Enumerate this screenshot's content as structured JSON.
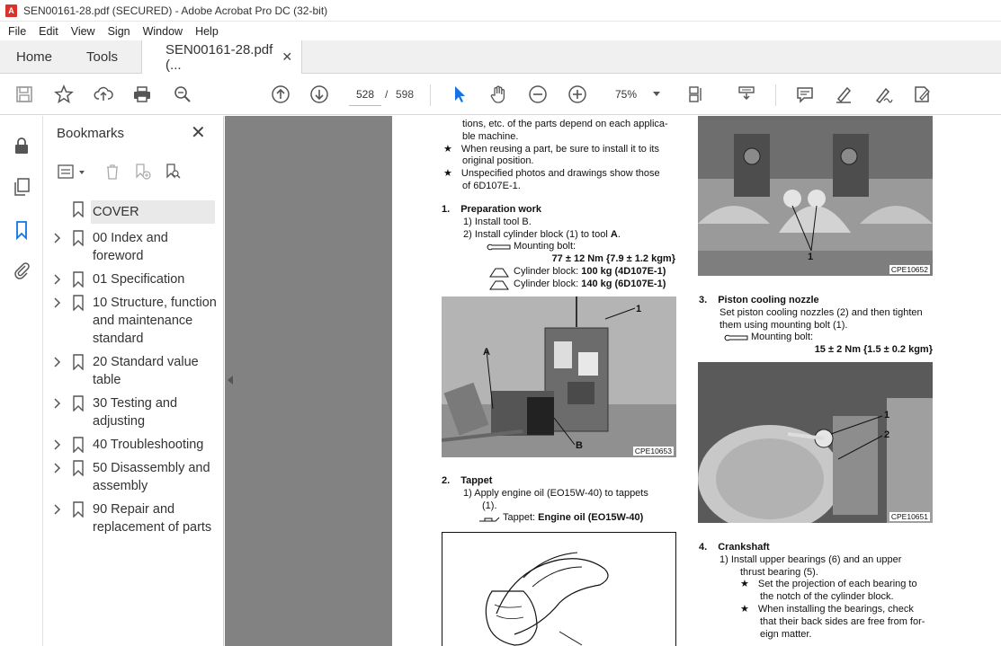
{
  "window": {
    "title": "SEN00161-28.pdf (SECURED) - Adobe Acrobat Pro DC (32-bit)"
  },
  "menu": [
    "File",
    "Edit",
    "View",
    "Sign",
    "Window",
    "Help"
  ],
  "tabs": {
    "home": "Home",
    "tools": "Tools",
    "document": "SEN00161-28.pdf (..."
  },
  "toolbar": {
    "current_page": "528",
    "page_separator": "/",
    "total_pages": "598",
    "zoom": "75%"
  },
  "bookmarks": {
    "header": "Bookmarks",
    "items": [
      {
        "label": "COVER",
        "expandable": false,
        "selected": true
      },
      {
        "label": "00 Index and foreword",
        "expandable": true
      },
      {
        "label": "01 Specification",
        "expandable": true
      },
      {
        "label": "10 Structure, function and maintenance standard",
        "expandable": true
      },
      {
        "label": "20 Standard value table",
        "expandable": true
      },
      {
        "label": "30 Testing and adjusting",
        "expandable": true
      },
      {
        "label": "40 Troubleshooting",
        "expandable": true
      },
      {
        "label": "50 Disassembly and assembly",
        "expandable": true
      },
      {
        "label": "90 Repair and replacement of parts",
        "expandable": true
      }
    ]
  },
  "document": {
    "left_top_lines": [
      "tions, etc. of the parts depend on each applica-",
      "ble machine."
    ],
    "notes": [
      [
        "When reusing a part, be sure to install it to its",
        "original position."
      ],
      [
        "Unspecified photos and drawings show those",
        "of 6D107E-1."
      ]
    ],
    "section1": {
      "number": "1.",
      "title": "Preparation work",
      "step1": "1)   Install tool B.",
      "step2_prefix": "2)   Install cylinder block (1) to tool ",
      "step2_tool": "A",
      "step2_suffix": ".",
      "torque_label": "Mounting bolt:",
      "torque_value": "77 ± 12 Nm {7.9 ± 1.2 kgm}",
      "weight1_prefix": "Cylinder block: ",
      "weight1_value": "100 kg (4D107E-1)",
      "weight2_prefix": "Cylinder block: ",
      "weight2_value": "140 kg (6D107E-1)",
      "photo_label": "CPE10653",
      "callouts": [
        "1",
        "A",
        "B"
      ]
    },
    "section2": {
      "number": "2.",
      "title": "Tappet",
      "step1_line1": "1)   Apply engine oil (EO15W-40) to tappets",
      "step1_line2": "(1).",
      "oil_prefix": "Tappet: ",
      "oil_value": "Engine oil (EO15W-40)"
    },
    "right_photo_top": {
      "label": "CPE10652",
      "callout": "1"
    },
    "section3": {
      "number": "3.",
      "title": "Piston cooling nozzle",
      "line1": "Set piston cooling nozzles (2) and then tighten",
      "line2": "them using mounting bolt (1).",
      "torque_label": "Mounting bolt:",
      "torque_value": "15 ± 2 Nm {1.5 ± 0.2 kgm}",
      "photo_label": "CPE10651",
      "callouts": [
        "1",
        "2"
      ]
    },
    "section4": {
      "number": "4.",
      "title": "Crankshaft",
      "step1_line1": "1)   Install upper bearings (6) and an upper",
      "step1_line2": "thrust bearing (5).",
      "notes": [
        [
          "Set the projection of each bearing to",
          "the notch of the cylinder block."
        ],
        [
          "When installing the bearings, check",
          "that their back sides are free from for-",
          "eign matter."
        ]
      ]
    },
    "star_glyph": "★"
  }
}
